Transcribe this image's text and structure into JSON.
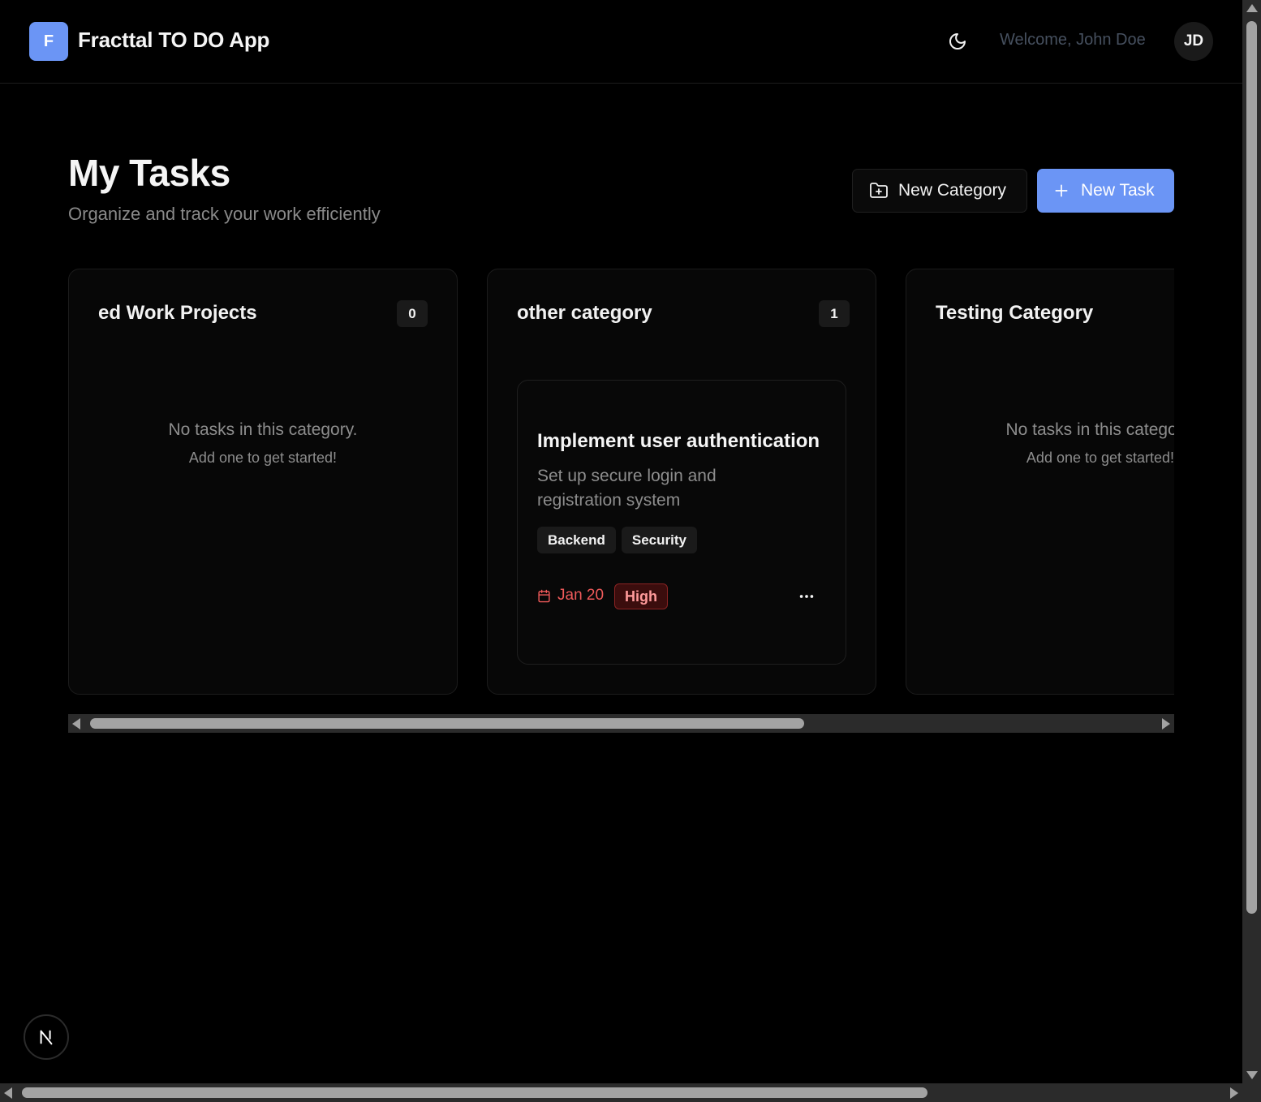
{
  "header": {
    "logo_letter": "F",
    "app_title": "Fracttal TO DO App",
    "theme_toggle_icon": "moon-icon",
    "welcome": "Welcome, John Doe",
    "avatar_initials": "JD"
  },
  "page": {
    "title": "My Tasks",
    "subtitle": "Organize and track your work efficiently",
    "new_category_label": "New Category",
    "new_task_label": "New Task"
  },
  "columns": [
    {
      "title": "ed Work Projects",
      "count": "0",
      "empty_main": "No tasks in this category.",
      "empty_sub": "Add one to get started!"
    },
    {
      "title": "other category",
      "count": "1",
      "tasks": [
        {
          "title": "Implement user authentication",
          "description": "Set up secure login and registration system",
          "tags": [
            "Backend",
            "Security"
          ],
          "due": "Jan 20",
          "priority": "High"
        }
      ]
    },
    {
      "title": "Testing Category",
      "empty_main": "No tasks in this category.",
      "empty_sub": "Add one to get started!"
    }
  ],
  "colors": {
    "accent": "#6b95f5",
    "priority_high_text": "#ff9b9b",
    "priority_high_bg": "#3b0d0d",
    "due_text": "#ef5a5a",
    "background": "#000000"
  },
  "badge": {
    "letter": "N"
  }
}
